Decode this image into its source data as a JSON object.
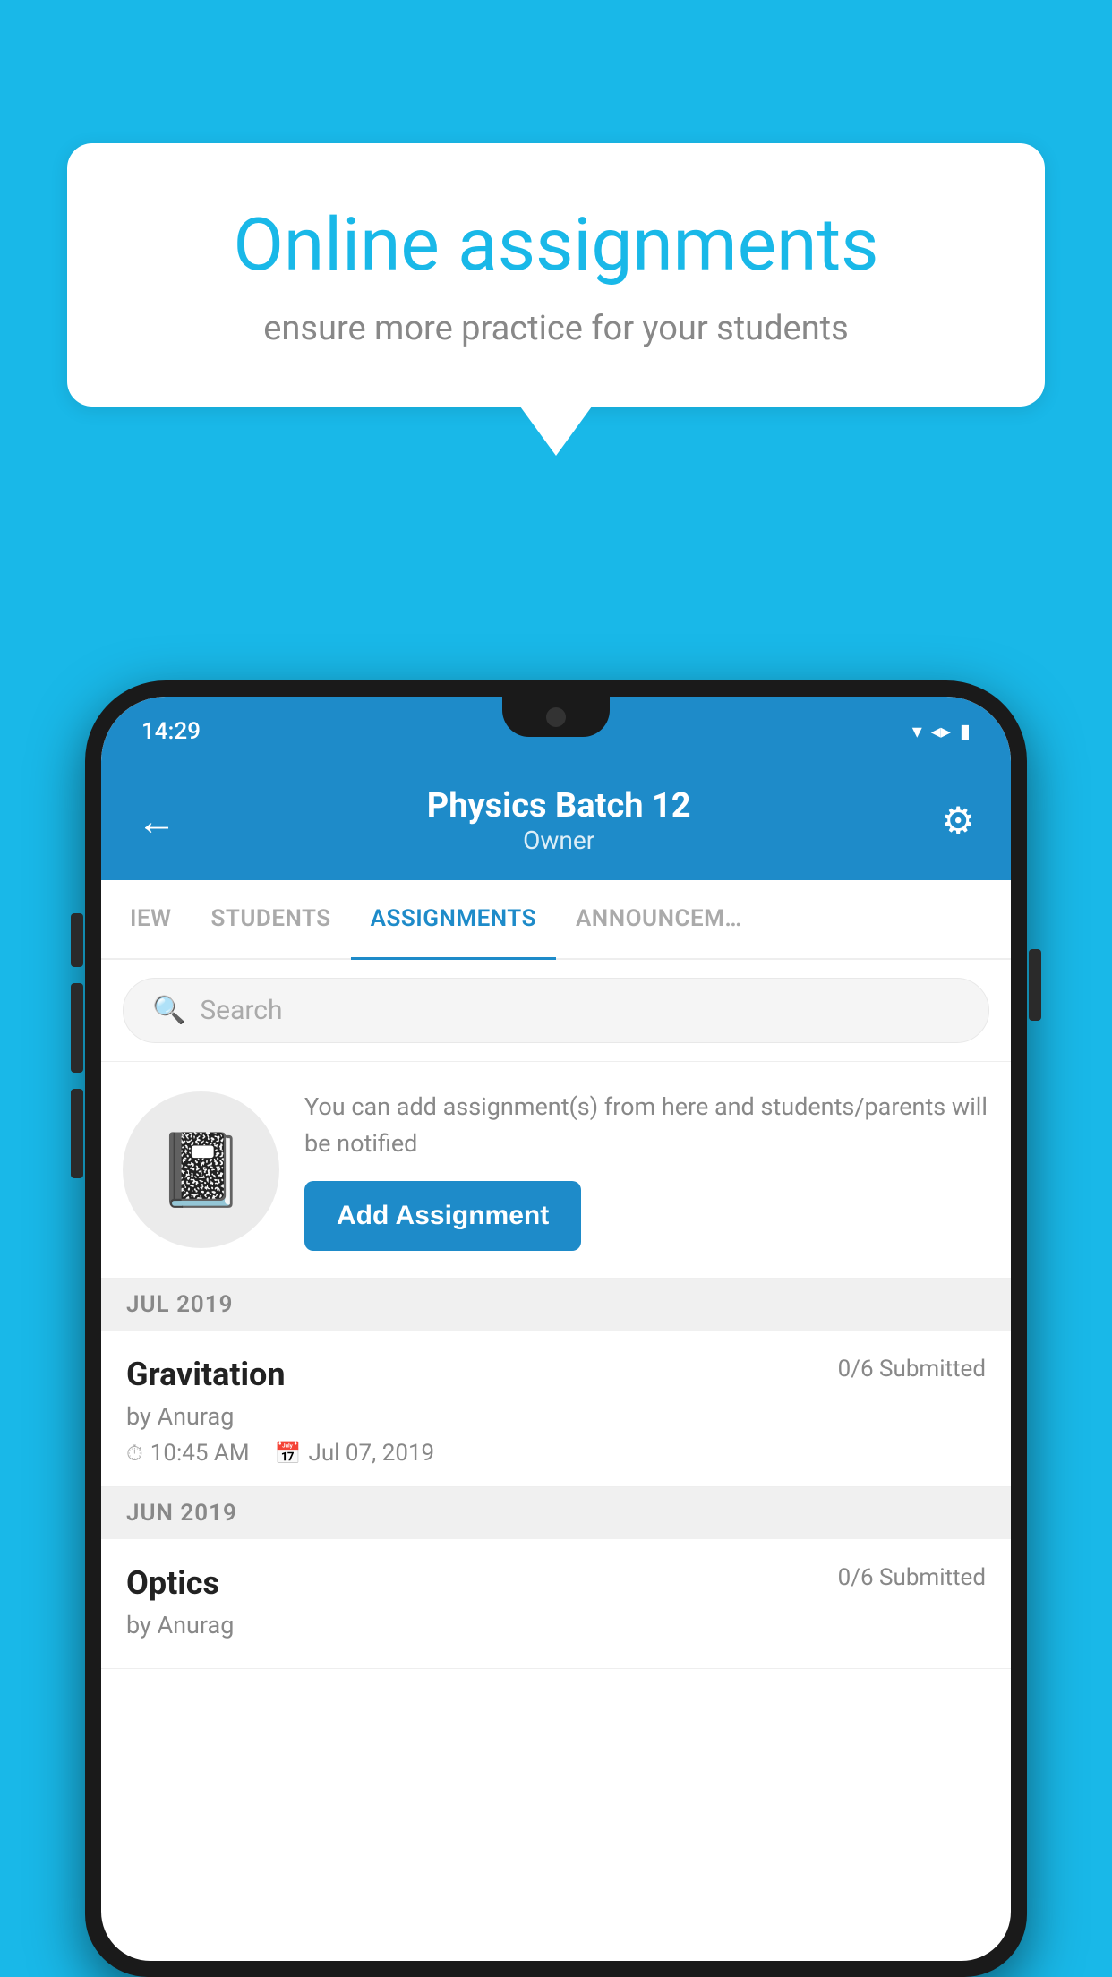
{
  "background_color": "#19b8e8",
  "speech_bubble": {
    "title": "Online assignments",
    "subtitle": "ensure more practice for your students"
  },
  "status_bar": {
    "time": "14:29",
    "icons": [
      "▾",
      "◂",
      "▮"
    ]
  },
  "header": {
    "title": "Physics Batch 12",
    "subtitle": "Owner",
    "back_label": "←",
    "gear_label": "⚙"
  },
  "tabs": [
    {
      "label": "IEW",
      "active": false
    },
    {
      "label": "STUDENTS",
      "active": false
    },
    {
      "label": "ASSIGNMENTS",
      "active": true
    },
    {
      "label": "ANNOUNCEM…",
      "active": false
    }
  ],
  "search": {
    "placeholder": "Search"
  },
  "promo": {
    "text": "You can add assignment(s) from here and students/parents will be notified",
    "button_label": "Add Assignment"
  },
  "sections": [
    {
      "label": "JUL 2019",
      "assignments": [
        {
          "title": "Gravitation",
          "submitted": "0/6 Submitted",
          "author": "by Anurag",
          "time": "10:45 AM",
          "date": "Jul 07, 2019"
        }
      ]
    },
    {
      "label": "JUN 2019",
      "assignments": [
        {
          "title": "Optics",
          "submitted": "0/6 Submitted",
          "author": "by Anurag",
          "time": "",
          "date": ""
        }
      ]
    }
  ]
}
